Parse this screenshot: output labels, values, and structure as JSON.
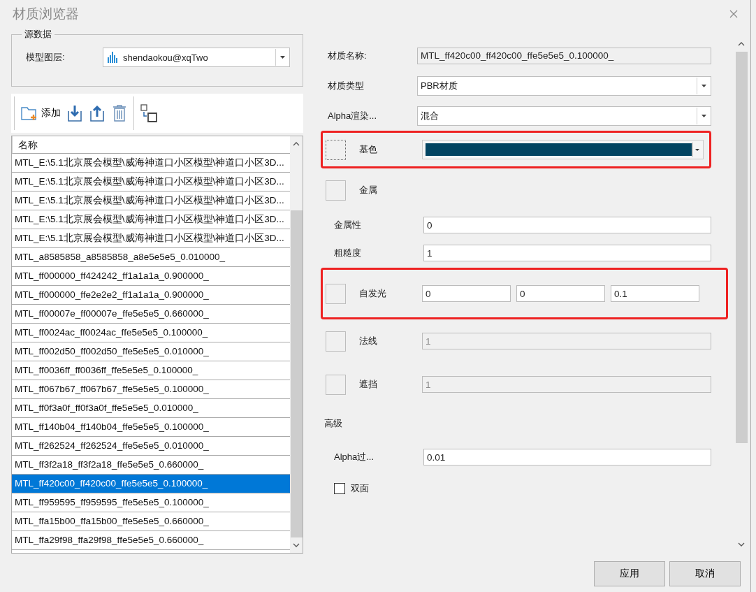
{
  "window": {
    "title": "材质浏览器"
  },
  "source": {
    "legend": "源数据",
    "layer_label": "模型图层:",
    "layer_value": "shendaokou@xqTwo"
  },
  "toolbar": {
    "add_label": "添加"
  },
  "list": {
    "column": "名称",
    "rows": [
      {
        "name": "MTL_E:\\5.1北京展会模型\\威海神道口小区模型\\神道口小区3D...",
        "selected": false
      },
      {
        "name": "MTL_E:\\5.1北京展会模型\\威海神道口小区模型\\神道口小区3D...",
        "selected": false
      },
      {
        "name": "MTL_E:\\5.1北京展会模型\\威海神道口小区模型\\神道口小区3D...",
        "selected": false
      },
      {
        "name": "MTL_E:\\5.1北京展会模型\\威海神道口小区模型\\神道口小区3D...",
        "selected": false
      },
      {
        "name": "MTL_E:\\5.1北京展会模型\\威海神道口小区模型\\神道口小区3D...",
        "selected": false
      },
      {
        "name": "MTL_a8585858_a8585858_a8e5e5e5_0.010000_",
        "selected": false
      },
      {
        "name": "MTL_ff000000_ff424242_ff1a1a1a_0.900000_",
        "selected": false
      },
      {
        "name": "MTL_ff000000_ffe2e2e2_ff1a1a1a_0.900000_",
        "selected": false
      },
      {
        "name": "MTL_ff00007e_ff00007e_ffe5e5e5_0.660000_",
        "selected": false
      },
      {
        "name": "MTL_ff0024ac_ff0024ac_ffe5e5e5_0.100000_",
        "selected": false
      },
      {
        "name": "MTL_ff002d50_ff002d50_ffe5e5e5_0.010000_",
        "selected": false
      },
      {
        "name": "MTL_ff0036ff_ff0036ff_ffe5e5e5_0.100000_",
        "selected": false
      },
      {
        "name": "MTL_ff067b67_ff067b67_ffe5e5e5_0.100000_",
        "selected": false
      },
      {
        "name": "MTL_ff0f3a0f_ff0f3a0f_ffe5e5e5_0.010000_",
        "selected": false
      },
      {
        "name": "MTL_ff140b04_ff140b04_ffe5e5e5_0.100000_",
        "selected": false
      },
      {
        "name": "MTL_ff262524_ff262524_ffe5e5e5_0.010000_",
        "selected": false
      },
      {
        "name": "MTL_ff3f2a18_ff3f2a18_ffe5e5e5_0.660000_",
        "selected": false
      },
      {
        "name": "MTL_ff420c00_ff420c00_ffe5e5e5_0.100000_",
        "selected": true
      },
      {
        "name": "MTL_ff959595_ff959595_ffe5e5e5_0.100000_",
        "selected": false
      },
      {
        "name": "MTL_ffa15b00_ffa15b00_ffe5e5e5_0.660000_",
        "selected": false
      },
      {
        "name": "MTL_ffa29f98_ffa29f98_ffe5e5e5_0.660000_",
        "selected": false
      }
    ]
  },
  "properties": {
    "name": {
      "label": "材质名称:",
      "value": "MTL_ff420c00_ff420c00_ffe5e5e5_0.100000_"
    },
    "type": {
      "label": "材质类型",
      "value": "PBR材质"
    },
    "alpha_mode": {
      "label": "Alpha渲染...",
      "value": "混合"
    },
    "base_color": {
      "label": "基色",
      "color": "#024461",
      "highlighted": true
    },
    "metal": {
      "label": "金属"
    },
    "metallic": {
      "label": "金属性",
      "value": "0"
    },
    "roughness": {
      "label": "粗糙度",
      "value": "1"
    },
    "emissive": {
      "label": "自发光",
      "values": [
        "0",
        "0",
        "0.1"
      ],
      "highlighted": true
    },
    "normal": {
      "label": "法线",
      "value": "1",
      "disabled": true
    },
    "occlusion": {
      "label": "遮挡",
      "value": "1",
      "disabled": true
    },
    "advanced": "高级",
    "alpha_cutoff": {
      "label": "Alpha过...",
      "value": "0.01"
    },
    "double_sided": {
      "label": "双面",
      "checked": false
    }
  },
  "buttons": [
    "应用",
    "取消"
  ]
}
